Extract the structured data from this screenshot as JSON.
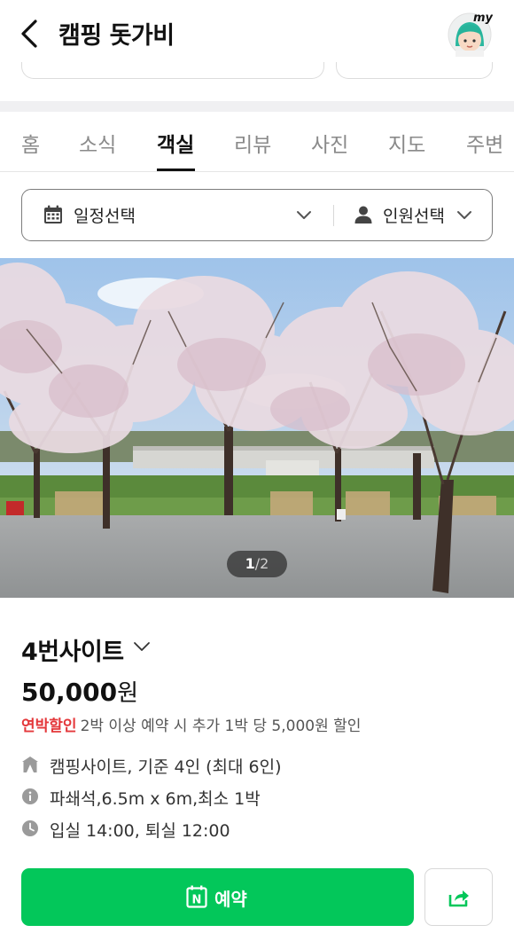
{
  "header": {
    "title": "캠핑 돗가비",
    "avatar_badge": "my"
  },
  "tabs": [
    {
      "label": "홈",
      "active": false
    },
    {
      "label": "소식",
      "active": false
    },
    {
      "label": "객실",
      "active": true
    },
    {
      "label": "리뷰",
      "active": false
    },
    {
      "label": "사진",
      "active": false
    },
    {
      "label": "지도",
      "active": false
    },
    {
      "label": "주변",
      "active": false
    }
  ],
  "filter": {
    "date_label": "일정선택",
    "people_label": "인원선택"
  },
  "photo": {
    "current": "1",
    "separator": "/",
    "total": "2"
  },
  "site": {
    "name": "4번사이트",
    "price": "50,000",
    "price_unit": "원",
    "discount_tag": "연박할인",
    "discount_text": "2박 이상 예약 시 추가 1박 당 5,000원 할인",
    "details": [
      {
        "icon": "tent-icon",
        "text": "캠핑사이트, 기준 4인 (최대 6인)"
      },
      {
        "icon": "info-icon",
        "text": "파쇄석,6.5m x 6m,최소 1박"
      },
      {
        "icon": "clock-icon",
        "text": "입실 14:00, 퇴실 12:00"
      }
    ]
  },
  "actions": {
    "reserve_label": "예약",
    "reserve_icon_letter": "N"
  },
  "colors": {
    "accent_green": "#03c75a",
    "discount_red": "#e4383b",
    "tab_active": "#111111",
    "tab_inactive": "#8a8a8a"
  }
}
